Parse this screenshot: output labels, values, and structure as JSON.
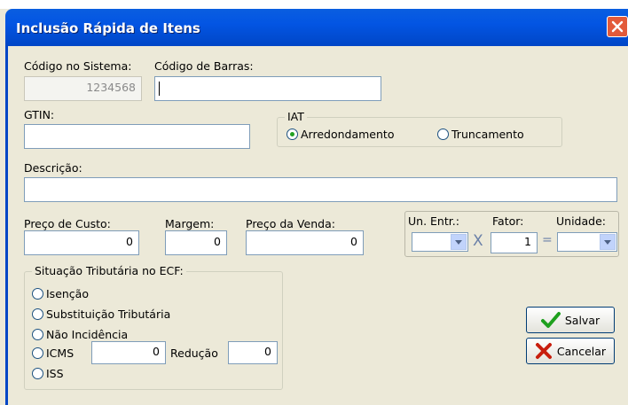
{
  "window": {
    "title": "Inclusão Rápida de Itens"
  },
  "codigo_sistema": {
    "label": "Código no Sistema:",
    "value": "1234568"
  },
  "codigo_barras": {
    "label": "Código de Barras:",
    "value": ""
  },
  "gtin": {
    "label": "GTIN:",
    "value": ""
  },
  "iat": {
    "label": "IAT",
    "options": [
      "Arredondamento",
      "Truncamento"
    ],
    "selected": "Arredondamento"
  },
  "descricao": {
    "label": "Descrição:",
    "value": ""
  },
  "preco_custo": {
    "label": "Preço de Custo:",
    "value": "0"
  },
  "margem": {
    "label": "Margem:",
    "value": "0"
  },
  "preco_venda": {
    "label": "Preço da Venda:",
    "value": "0"
  },
  "conversao": {
    "un_entr_label": "Un. Entr.:",
    "fator_label": "Fator:",
    "unidade_label": "Unidade:",
    "fator_value": "1",
    "un_entr_value": "",
    "unidade_value": "",
    "times_symbol": "X",
    "equals_symbol": "="
  },
  "situacao": {
    "label": "Situação Tributária no ECF:",
    "options": [
      "Isenção",
      "Substituição Tributária",
      "Não Incidência",
      "ICMS",
      "ISS"
    ],
    "icms_value": "0",
    "reducao_label": "Redução",
    "reducao_value": "0"
  },
  "buttons": {
    "salvar": "Salvar",
    "cancelar": "Cancelar"
  },
  "colors": {
    "titlebar": "#0355e3",
    "dialog_bg": "#ece9d8",
    "check": "#1ea01e",
    "cancel_x": "#c81e0e"
  },
  "icons": [
    "close-icon",
    "check-icon",
    "cancel-x-icon",
    "chevron-down-icon"
  ]
}
